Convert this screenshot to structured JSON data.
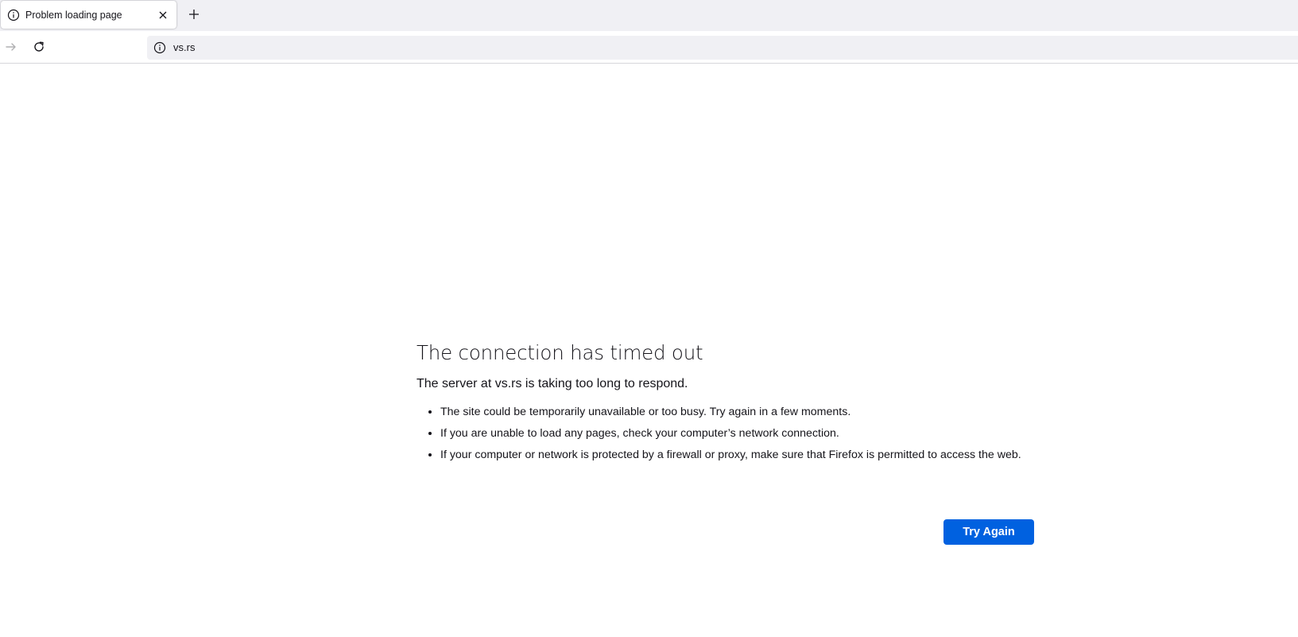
{
  "browser": {
    "tab": {
      "title": "Problem loading page",
      "icon": "info-icon",
      "close_icon": "close-icon"
    },
    "new_tab_icon": "plus-icon",
    "nav": {
      "forward_icon": "arrow-right-icon",
      "reload_icon": "reload-icon"
    },
    "urlbar": {
      "icon": "info-icon",
      "url": "vs.rs"
    }
  },
  "error_page": {
    "title": "The connection has timed out",
    "subtitle": "The server at vs.rs is taking too long to respond.",
    "bullets": [
      "The site could be temporarily unavailable or too busy. Try again in a few moments.",
      "If you are unable to load any pages, check your computer’s network connection.",
      "If your computer or network is protected by a firewall or proxy, make sure that Firefox is permitted to access the web."
    ],
    "button_label": "Try Again"
  },
  "colors": {
    "accent": "#0061e0",
    "chrome_background": "#f0f0f4",
    "text": "#15141a"
  }
}
